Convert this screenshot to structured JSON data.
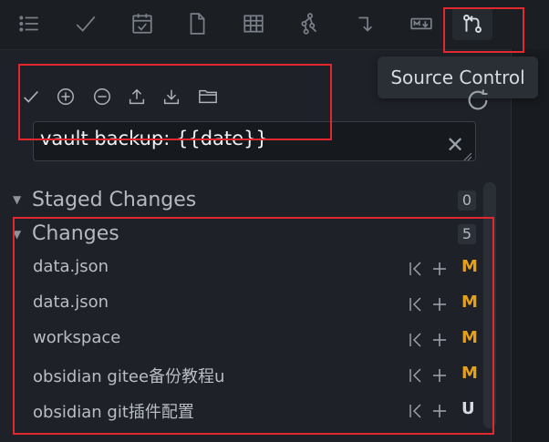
{
  "topbar": {
    "icons": [
      "list-icon",
      "check-icon",
      "calendar-icon",
      "document-icon",
      "table-icon",
      "graph-icon",
      "arrow-icon",
      "markdown-icon",
      "source-control-icon"
    ]
  },
  "tooltip": {
    "label": "Source Control"
  },
  "toolbar": {
    "actions": [
      "commit-icon",
      "stage-all-icon",
      "unstage-all-icon",
      "push-icon",
      "pull-icon",
      "open-folder-icon"
    ]
  },
  "commit": {
    "message": "vault backup: {{date}}"
  },
  "staged": {
    "title": "Staged Changes",
    "count": "0"
  },
  "changes": {
    "title": "Changes",
    "count": "5",
    "files": [
      {
        "name": "data.json",
        "status": "M"
      },
      {
        "name": "data.json",
        "status": "M"
      },
      {
        "name": "workspace",
        "status": "M"
      },
      {
        "name": "obsidian gitee备份教程u",
        "status": "M"
      },
      {
        "name": "obsidian git插件配置",
        "status": "U"
      }
    ]
  },
  "colors": {
    "modified": "#e5a11a",
    "untracked": "#d8dbe0",
    "highlight": "#e0282e"
  }
}
